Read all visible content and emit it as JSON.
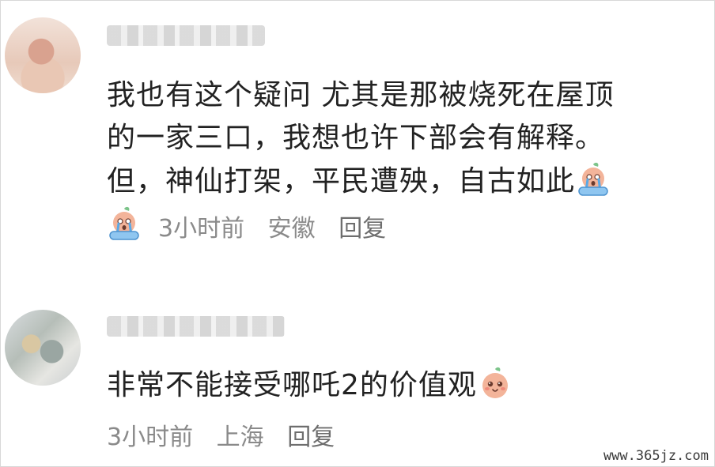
{
  "comments": [
    {
      "text_lines": [
        "我也有这个疑问 尤其是那被烧死在屋顶",
        "的一家三口，我想也许下部会有解释。",
        "但，神仙打架，平民遭殃，自古如此"
      ],
      "time": "3小时前",
      "location": "安徽",
      "reply_label": "回复",
      "emoji": "crying-peach-emoji"
    },
    {
      "text_lines": [
        "非常不能接受哪吒2的价值观"
      ],
      "time": "3小时前",
      "location": "上海",
      "reply_label": "回复",
      "emoji": "smiling-peach-emoji"
    }
  ],
  "watermark": "www.365jz.com",
  "colors": {
    "text": "#222222",
    "meta": "#8a8a8a",
    "peach": "#f3b49a"
  }
}
